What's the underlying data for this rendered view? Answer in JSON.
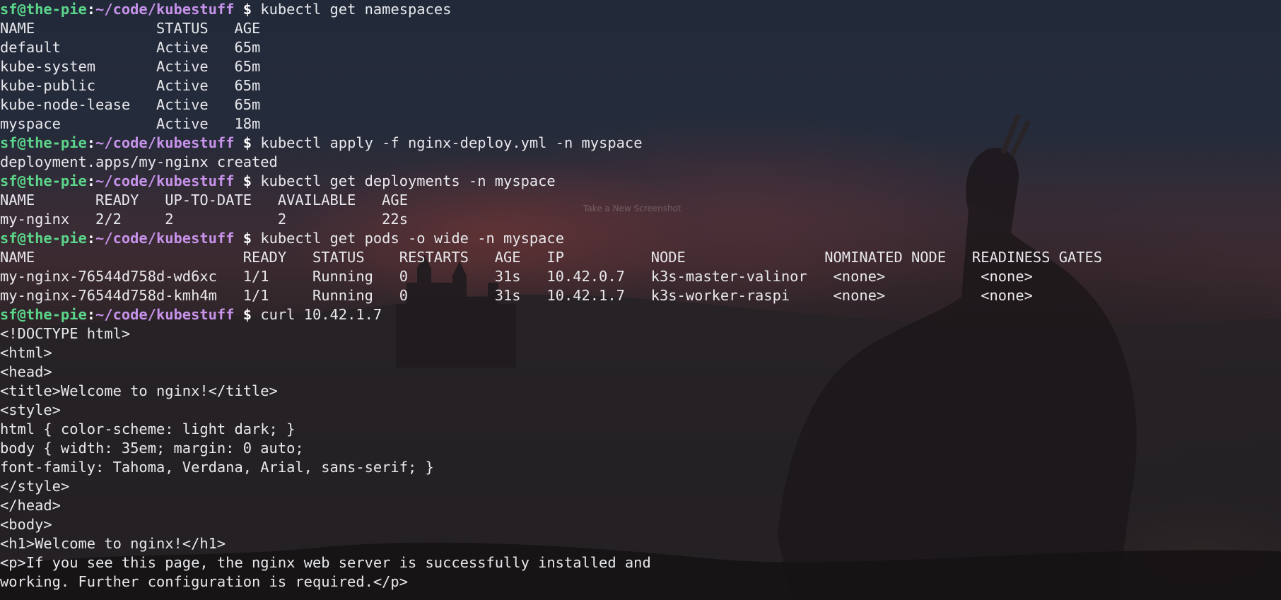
{
  "prompt": {
    "user_host": "sf@the-pie",
    "separator": ":",
    "path": "~/code/kubestuff",
    "symbol": " $ "
  },
  "watermark": "Take a New Screenshot",
  "lines": [
    {
      "type": "cmd",
      "text": "kubectl get namespaces"
    },
    {
      "type": "out",
      "text": "NAME              STATUS   AGE"
    },
    {
      "type": "out",
      "text": "default           Active   65m"
    },
    {
      "type": "out",
      "text": "kube-system       Active   65m"
    },
    {
      "type": "out",
      "text": "kube-public       Active   65m"
    },
    {
      "type": "out",
      "text": "kube-node-lease   Active   65m"
    },
    {
      "type": "out",
      "text": "myspace           Active   18m"
    },
    {
      "type": "cmd",
      "text": "kubectl apply -f nginx-deploy.yml -n myspace"
    },
    {
      "type": "out",
      "text": "deployment.apps/my-nginx created"
    },
    {
      "type": "cmd",
      "text": "kubectl get deployments -n myspace"
    },
    {
      "type": "out",
      "text": "NAME       READY   UP-TO-DATE   AVAILABLE   AGE"
    },
    {
      "type": "out",
      "text": "my-nginx   2/2     2            2           22s"
    },
    {
      "type": "cmd",
      "text": "kubectl get pods -o wide -n myspace"
    },
    {
      "type": "out",
      "text": "NAME                        READY   STATUS    RESTARTS   AGE   IP          NODE                NOMINATED NODE   READINESS GATES"
    },
    {
      "type": "out",
      "text": "my-nginx-76544d758d-wd6xc   1/1     Running   0          31s   10.42.0.7   k3s-master-valinor   <none>           <none>"
    },
    {
      "type": "out",
      "text": "my-nginx-76544d758d-kmh4m   1/1     Running   0          31s   10.42.1.7   k3s-worker-raspi     <none>           <none>"
    },
    {
      "type": "cmd",
      "text": "curl 10.42.1.7"
    },
    {
      "type": "out",
      "text": "<!DOCTYPE html>"
    },
    {
      "type": "out",
      "text": "<html>"
    },
    {
      "type": "out",
      "text": "<head>"
    },
    {
      "type": "out",
      "text": "<title>Welcome to nginx!</title>"
    },
    {
      "type": "out",
      "text": "<style>"
    },
    {
      "type": "out",
      "text": "html { color-scheme: light dark; }"
    },
    {
      "type": "out",
      "text": "body { width: 35em; margin: 0 auto;"
    },
    {
      "type": "out",
      "text": "font-family: Tahoma, Verdana, Arial, sans-serif; }"
    },
    {
      "type": "out",
      "text": "</style>"
    },
    {
      "type": "out",
      "text": "</head>"
    },
    {
      "type": "out",
      "text": "<body>"
    },
    {
      "type": "out",
      "text": "<h1>Welcome to nginx!</h1>"
    },
    {
      "type": "out",
      "text": "<p>If you see this page, the nginx web server is successfully installed and"
    },
    {
      "type": "out",
      "text": "working. Further configuration is required.</p>"
    }
  ]
}
